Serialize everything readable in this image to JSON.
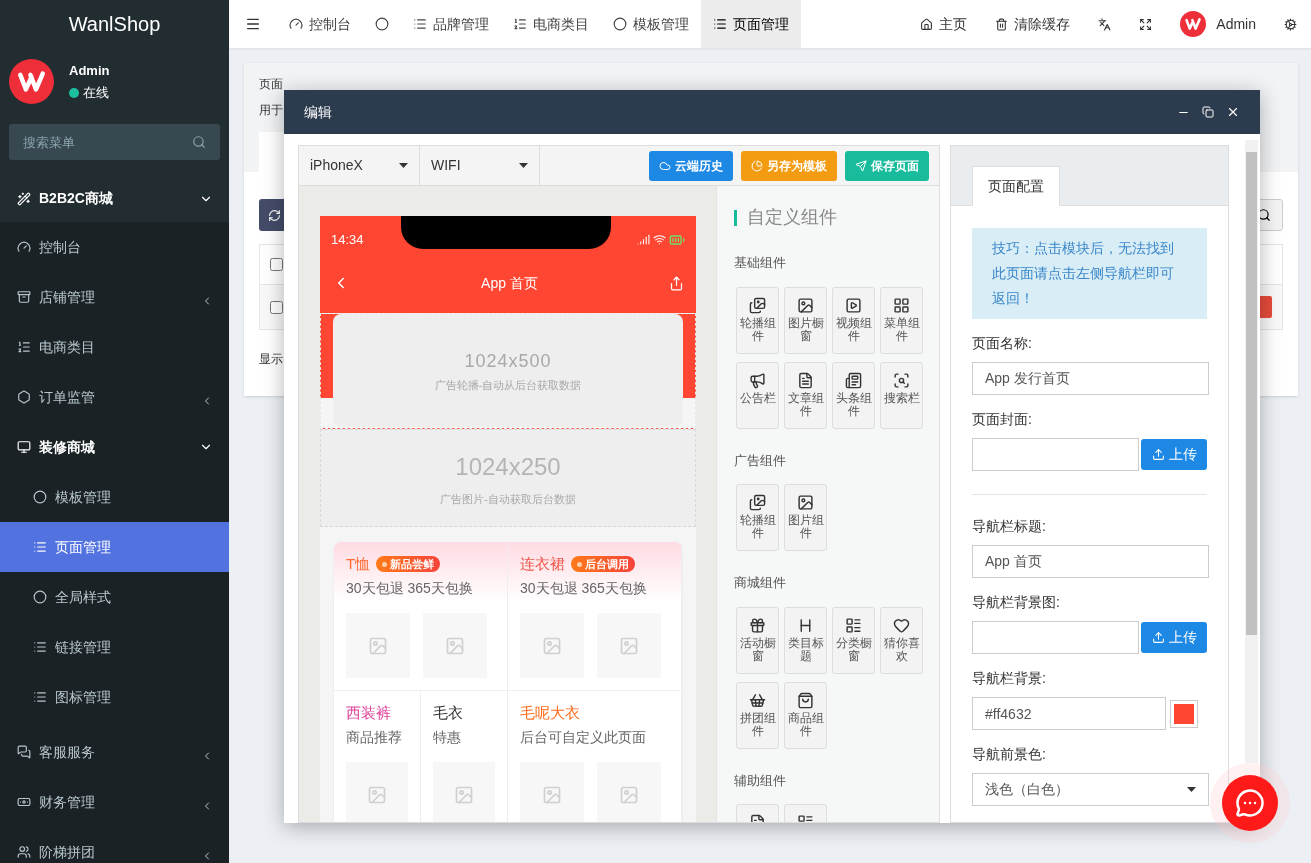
{
  "sidebar": {
    "brand": "WanlShop",
    "user": {
      "name": "Admin",
      "status": "在线"
    },
    "search": {
      "placeholder": "搜索菜单"
    },
    "items": [
      {
        "kind": "header",
        "label": "B2B2C商城",
        "expanded": true,
        "selected": false
      },
      {
        "kind": "item",
        "label": "控制台",
        "selected": false
      },
      {
        "kind": "submenu",
        "label": "店铺管理",
        "expanded": false,
        "selected": false
      },
      {
        "kind": "item",
        "label": "电商类目",
        "selected": false
      },
      {
        "kind": "submenu",
        "label": "订单监管",
        "expanded": false,
        "selected": false
      },
      {
        "kind": "submenu",
        "label": "装修商城",
        "expanded": true,
        "selected": false,
        "children": [
          {
            "label": "模板管理",
            "selected": false
          },
          {
            "label": "页面管理",
            "selected": true
          },
          {
            "label": "全局样式",
            "selected": false
          },
          {
            "label": "链接管理",
            "selected": false
          },
          {
            "label": "图标管理",
            "selected": false
          }
        ]
      },
      {
        "kind": "submenu",
        "label": "客服服务",
        "expanded": false,
        "selected": false
      },
      {
        "kind": "submenu",
        "label": "财务管理",
        "expanded": false,
        "selected": false
      },
      {
        "kind": "submenu",
        "label": "阶梯拼团",
        "expanded": false,
        "selected": false
      }
    ]
  },
  "topnav": {
    "tabs": [
      {
        "label": "控制台",
        "selected": false
      },
      {
        "selected": false
      },
      {
        "label": "品牌管理",
        "selected": false
      },
      {
        "label": "电商类目",
        "selected": false
      },
      {
        "label": "模板管理",
        "selected": false
      },
      {
        "label": "页面管理",
        "selected": true
      }
    ],
    "tools": [
      {
        "kind": "link",
        "label": "主页"
      },
      {
        "kind": "link",
        "label": "清除缓存"
      },
      {
        "kind": "icon"
      },
      {
        "kind": "icon"
      },
      {
        "kind": "user",
        "label": "Admin"
      },
      {
        "kind": "icon"
      }
    ]
  },
  "background": {
    "title": "页面",
    "subtitle": "用于",
    "select_all": {
      "checked": false
    },
    "rows": [
      {
        "checked": false
      }
    ],
    "footer": "显示"
  },
  "modal": {
    "title": "编辑",
    "device": "iPhoneX",
    "network": "WIFI",
    "actions": [
      {
        "label": "云端历史",
        "color": "#1e88e5"
      },
      {
        "label": "另存为模板",
        "color": "#f39c12"
      },
      {
        "label": "保存页面",
        "color": "#18bc9c"
      }
    ],
    "phone": {
      "time": "14:34",
      "title": "App 首页",
      "banner": {
        "size": "1024x500",
        "caption": "广告轮播-自动从后台获取数据"
      },
      "ad": {
        "size": "1024x250",
        "caption": "广告图片-自动获取后台数据"
      },
      "products": [
        {
          "kind": "half",
          "title": "T恤",
          "color": "#ff6b35",
          "badge": "新品尝鲜",
          "subtitle": "30天包退 365天包换",
          "images": [
            {
              "kind": "placeholder"
            },
            {
              "kind": "placeholder"
            }
          ]
        },
        {
          "kind": "half",
          "title": "连衣裙",
          "color": "#f0564a",
          "badge": "后台调用",
          "subtitle": "30天包退 365天包换",
          "images": [
            {
              "kind": "placeholder"
            },
            {
              "kind": "placeholder"
            }
          ]
        },
        {
          "kind": "quarter",
          "title": "西装裤",
          "color": "#e0449a",
          "subtitle": "商品推荐",
          "images": [
            {
              "kind": "placeholder"
            }
          ]
        },
        {
          "kind": "quarter",
          "title": "毛衣",
          "color": "#333333",
          "subtitle": "特惠",
          "images": [
            {
              "kind": "placeholder"
            }
          ]
        },
        {
          "kind": "half",
          "title": "毛呢大衣",
          "color": "#ff6b1a",
          "subtitle": "后台可自定义此页面",
          "images": [
            {
              "kind": "placeholder"
            },
            {
              "kind": "placeholder"
            }
          ]
        }
      ]
    },
    "components": {
      "title": "自定义组件",
      "groups": [
        {
          "name": "基础组件",
          "items": [
            {
              "kind": "tile",
              "label": "轮播组件"
            },
            {
              "kind": "tile",
              "label": "图片橱窗"
            },
            {
              "kind": "tile",
              "label": "视频组件"
            },
            {
              "kind": "tile",
              "label": "菜单组件"
            },
            {
              "kind": "tile",
              "label": "公告栏"
            },
            {
              "kind": "tile",
              "label": "文章组件"
            },
            {
              "kind": "tile",
              "label": "头条组件"
            },
            {
              "kind": "tile",
              "label": "搜索栏"
            }
          ]
        },
        {
          "name": "广告组件",
          "items": [
            {
              "kind": "tile",
              "label": "轮播组件"
            },
            {
              "kind": "tile",
              "label": "图片组件"
            }
          ]
        },
        {
          "name": "商城组件",
          "items": [
            {
              "kind": "tile",
              "label": "活动橱窗"
            },
            {
              "kind": "tile",
              "label": "类目标题"
            },
            {
              "kind": "tile",
              "label": "分类橱窗"
            },
            {
              "kind": "tile",
              "label": "猜你喜欢"
            },
            {
              "kind": "tile",
              "label": "拼团组件"
            },
            {
              "kind": "tile",
              "label": "商品组件"
            }
          ]
        },
        {
          "name": "辅助组件",
          "items": [
            {
              "kind": "cut"
            },
            {
              "kind": "cut"
            }
          ]
        }
      ]
    },
    "config": {
      "tabs": [
        {
          "label": "页面配置",
          "selected": true
        }
      ],
      "tip": "技巧：点击模块后，无法找到此页面请点击左侧导航栏即可返回！",
      "fields": [
        {
          "kind": "text",
          "label": "页面名称:",
          "value": "App 发行首页"
        },
        {
          "kind": "upload",
          "label": "页面封面:",
          "button": "上传"
        },
        {
          "kind": "text",
          "label": "导航栏标题:",
          "value": "App 首页",
          "divider_before": true
        },
        {
          "kind": "upload",
          "label": "导航栏背景图:",
          "button": "上传"
        },
        {
          "kind": "color",
          "label": "导航栏背景:",
          "value": "#ff4632"
        },
        {
          "kind": "select",
          "label": "导航前景色:",
          "value": "浅色（白色）"
        }
      ]
    }
  }
}
